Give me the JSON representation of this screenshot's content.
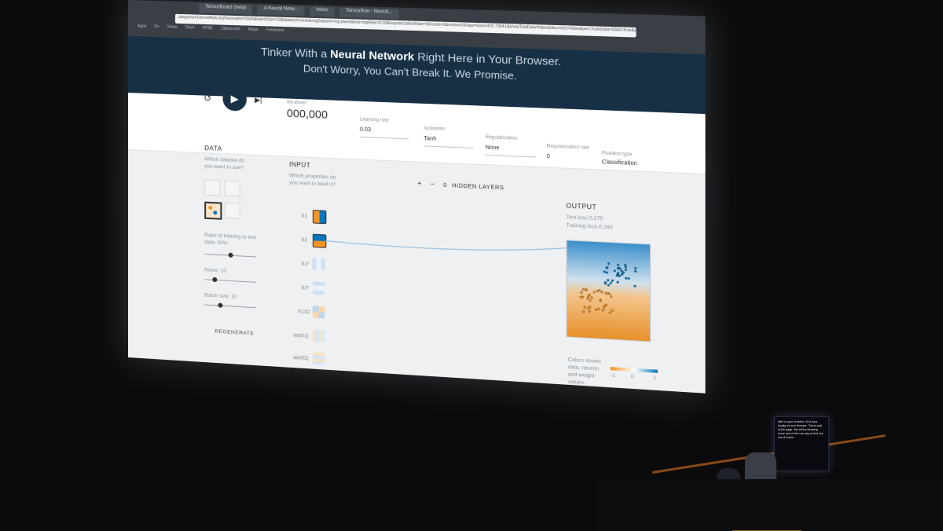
{
  "browser": {
    "tabs": [
      "TensorBoard (beta)",
      "A Neural Netw...",
      "Inbox",
      "Tensorflow - Neural..."
    ],
    "address": "playground.tensorflow.org/#activation=tanh&batchSize=10&dataset=circle&regDataset=reg-plane&learningRate=0.03&regularizationRate=0&noise=0&networkShape=&seed=0.73641&showTestData=false&discretize=false&percTrainData=50&x=true&y=true",
    "bookmarks": [
      "Apps",
      "G+",
      "News",
      "Drive",
      "HTML",
      "Classroom",
      "Maps",
      "Freeforms"
    ]
  },
  "header": {
    "line1_prefix": "Tinker With a ",
    "line1_bold": "Neural Network",
    "line1_suffix": " Right Here in Your Browser.",
    "line2": "Don't Worry, You Can't Break It. We Promise."
  },
  "controls": {
    "reset_icon": "reset-icon",
    "play_icon": "play-icon",
    "step_icon": "step-icon",
    "iterations_label": "Iterations",
    "iterations_value": "000,000",
    "learning_rate_label": "Learning rate",
    "learning_rate_value": "0.03",
    "activation_label": "Activation",
    "activation_value": "Tanh",
    "regularization_label": "Regularization",
    "regularization_value": "None",
    "reg_rate_label": "Regularization rate",
    "reg_rate_value": "0",
    "problem_type_label": "Problem type",
    "problem_type_value": "Classification"
  },
  "data_panel": {
    "title": "DATA",
    "question": "Which dataset do you want to use?",
    "ratio_label": "Ratio of training to test data:",
    "ratio_value": "50%",
    "ratio_fraction": 0.5,
    "noise_label": "Noise:",
    "noise_value": "10",
    "noise_fraction": 0.2,
    "batch_label": "Batch size:",
    "batch_value": "10",
    "batch_fraction": 0.3,
    "regenerate_label": "REGENERATE"
  },
  "input_panel": {
    "title": "INPUT",
    "question": "Which properties do you want to feed in?",
    "features": [
      "X1",
      "X2",
      "X1²",
      "X2²",
      "X1X2",
      "sin(X1)",
      "sin(X2)"
    ]
  },
  "hidden_layers": {
    "plus": "+",
    "minus": "−",
    "count": "0",
    "label": "HIDDEN LAYERS"
  },
  "output_panel": {
    "title": "OUTPUT",
    "test_loss": "Test loss 0.275",
    "training_loss": "Training loss 0.260",
    "legend_text": "Colors shows data, neuron and weight values.",
    "legend_min": "-1",
    "legend_mid": "0",
    "legend_max": "1"
  },
  "caption_screen": {
    "text": "with on your browser. So it runs locally on your browser. This is part of the page. We will be showing some sort of the one way to find out how it works."
  },
  "colors": {
    "header_bg": "#183046",
    "orange": "#f59322",
    "blue": "#0877bd"
  }
}
